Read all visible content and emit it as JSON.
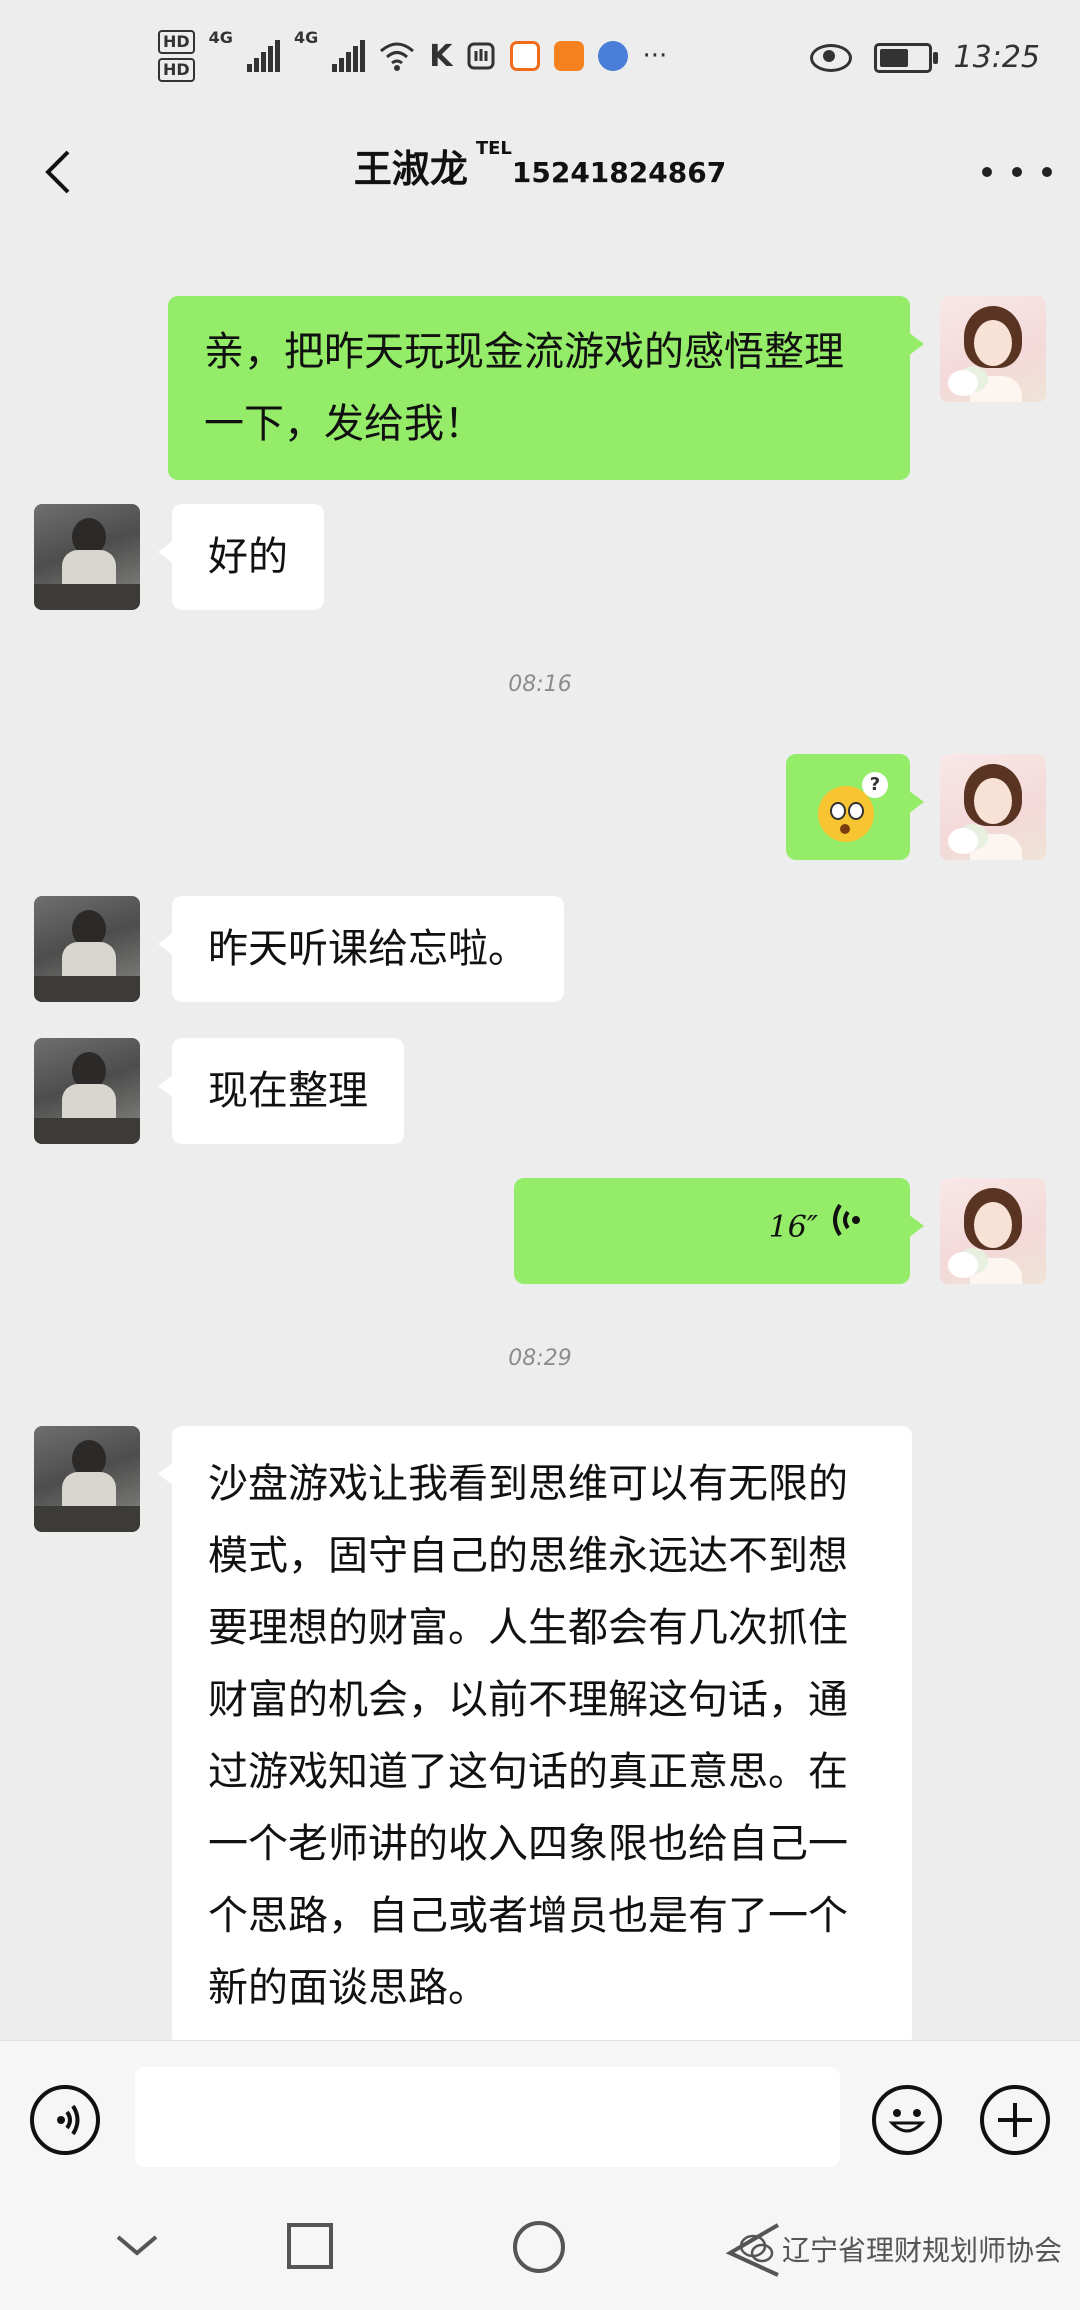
{
  "status_bar": {
    "hd1": "HD",
    "hd2": "HD",
    "net1": "4G",
    "net2": "4G",
    "carrier_k": "K",
    "more_icons": "···",
    "time": "13:25"
  },
  "header": {
    "title": "王淑龙",
    "tel_tag": "TEL",
    "tel_number": "15241824867",
    "back_icon": "chevron-left-icon",
    "more_icon": "more-dots-icon"
  },
  "messages": {
    "m1": "亲，把昨天玩现金流游戏的感悟整理一下，发给我！",
    "m2": "好的",
    "t1": "08:16",
    "m3_emoji": "confused-emoji",
    "m4": "昨天听课给忘啦。",
    "m5": "现在整理",
    "m6_duration": "16″",
    "t2": "08:29",
    "m7": "沙盘游戏让我看到思维可以有无限的模式，固守自己的思维永远达不到想要理想的财富。人生都会有几次抓住财富的机会，以前不理解这句话，通过游戏知道了这句话的真正意思。在一个老师讲的收入四象限也给自己一个思路，自己或者增员也是有了一个新的面谈思路。"
  },
  "input_bar": {
    "placeholder": "",
    "voice_icon": "voice-icon",
    "emoji_icon": "emoji-icon",
    "plus_icon": "plus-icon"
  },
  "nav_bar": {
    "watermark": "辽宁省理财规划师协会"
  },
  "colors": {
    "self_bubble": "#95ec69",
    "other_bubble": "#ffffff",
    "background": "#ededed"
  }
}
